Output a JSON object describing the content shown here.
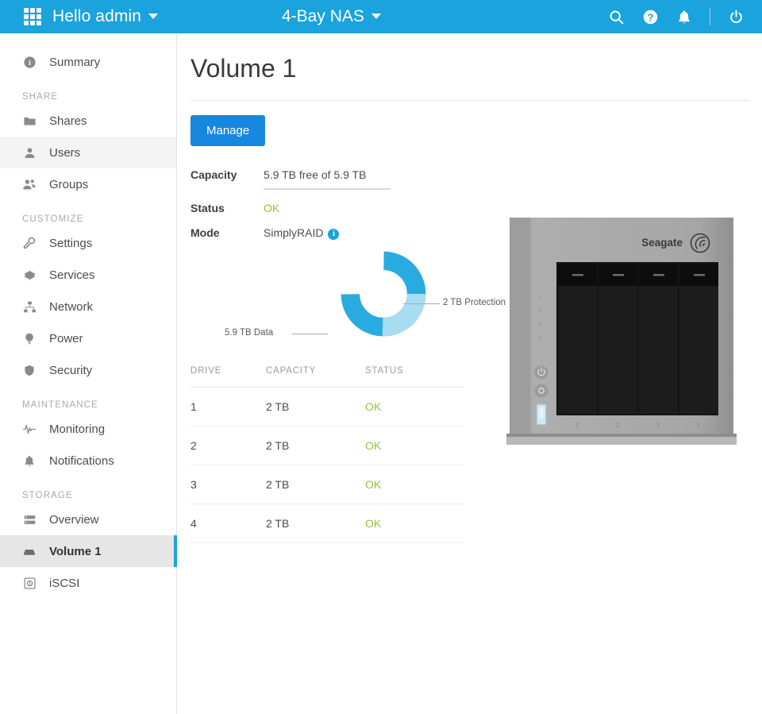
{
  "topbar": {
    "apps_icon": "app-grid-icon",
    "greeting": "Hello admin",
    "device_name": "4-Bay NAS",
    "icons": [
      "search-icon",
      "help-icon",
      "notifications-icon",
      "power-icon"
    ]
  },
  "sidebar": {
    "items": [
      {
        "label": "Summary",
        "icon": "info-icon",
        "state": "normal"
      }
    ],
    "groups": [
      {
        "title": "SHARE",
        "items": [
          {
            "label": "Shares",
            "icon": "folder-icon",
            "state": "normal"
          },
          {
            "label": "Users",
            "icon": "user-icon",
            "state": "hover"
          },
          {
            "label": "Groups",
            "icon": "users-icon",
            "state": "normal"
          }
        ]
      },
      {
        "title": "CUSTOMIZE",
        "items": [
          {
            "label": "Settings",
            "icon": "wrench-icon",
            "state": "normal"
          },
          {
            "label": "Services",
            "icon": "gear-icon",
            "state": "normal"
          },
          {
            "label": "Network",
            "icon": "network-icon",
            "state": "normal"
          },
          {
            "label": "Power",
            "icon": "bulb-icon",
            "state": "normal"
          },
          {
            "label": "Security",
            "icon": "shield-icon",
            "state": "normal"
          }
        ]
      },
      {
        "title": "MAINTENANCE",
        "items": [
          {
            "label": "Monitoring",
            "icon": "pulse-icon",
            "state": "normal"
          },
          {
            "label": "Notifications",
            "icon": "bell-icon",
            "state": "normal"
          }
        ]
      },
      {
        "title": "STORAGE",
        "items": [
          {
            "label": "Overview",
            "icon": "server-icon",
            "state": "normal"
          },
          {
            "label": "Volume 1",
            "icon": "drive-icon",
            "state": "active"
          },
          {
            "label": "iSCSI",
            "icon": "iscsi-icon",
            "state": "normal"
          }
        ]
      }
    ]
  },
  "main": {
    "title": "Volume 1",
    "manage_label": "Manage",
    "details": [
      {
        "label": "Capacity",
        "value": "5.9 TB free of 5.9 TB",
        "meter": true
      },
      {
        "label": "Status",
        "value": "OK",
        "status": "ok"
      },
      {
        "label": "Mode",
        "value": "SimplyRAID",
        "info_icon": "info-icon"
      }
    ],
    "table": {
      "columns": [
        "DRIVE",
        "CAPACITY",
        "STATUS"
      ],
      "rows": [
        {
          "drive": "1",
          "capacity": "2 TB",
          "status": "OK"
        },
        {
          "drive": "2",
          "capacity": "2 TB",
          "status": "OK"
        },
        {
          "drive": "3",
          "capacity": "2 TB",
          "status": "OK"
        },
        {
          "drive": "4",
          "capacity": "2 TB",
          "status": "OK"
        }
      ]
    },
    "device_image": {
      "brand": "Seagate",
      "bay_labels": [
        "1",
        "2",
        "3",
        "4"
      ],
      "indicators": [
        "power-icon",
        "status-icon",
        "usb-port"
      ]
    }
  },
  "chart_data": {
    "type": "pie",
    "title": "",
    "labels": [
      "5.9 TB Data",
      "2 TB Protection"
    ],
    "values": [
      5.9,
      2.0
    ],
    "display_values": [
      "5.9 TB Data",
      "2 TB Protection"
    ],
    "colors": [
      "#29ABE2",
      "#A8DCF0"
    ],
    "legend": "callout-labels",
    "donut": true,
    "inner_radius_ratio": 0.52
  },
  "colors": {
    "brand_blue": "#1AA3DC",
    "button_blue": "#1787E0",
    "status_green": "#8CC63E",
    "data_blue": "#29ABE2",
    "protection_blue": "#A8DCF0"
  }
}
